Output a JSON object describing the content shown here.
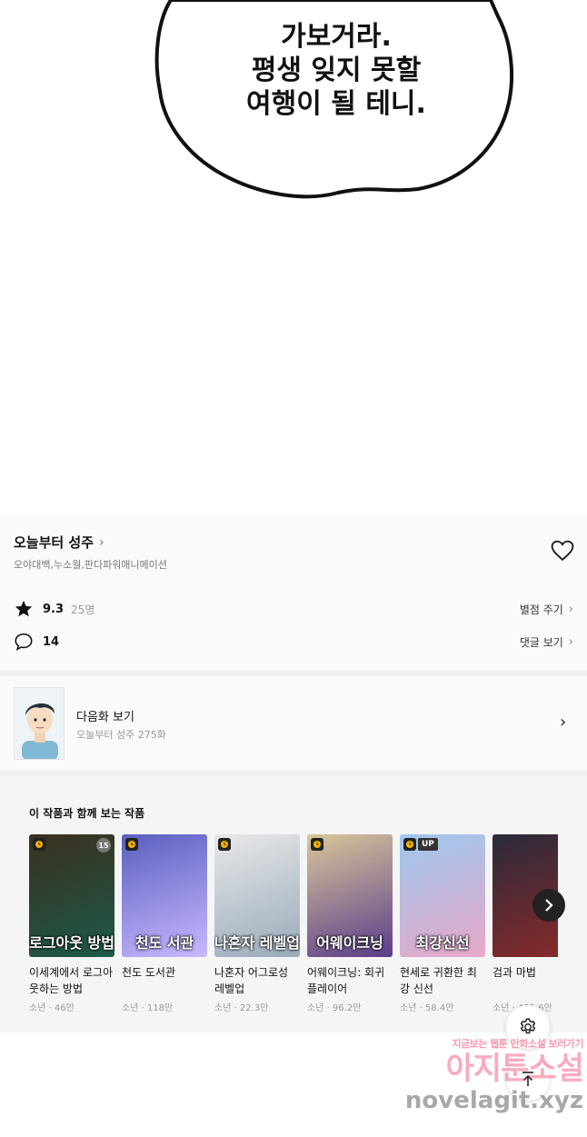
{
  "comic": {
    "speech_lines": [
      "가보거라.",
      "평생 잊지 못할",
      "여행이 될 테니."
    ]
  },
  "series": {
    "title": "오늘부터 성주",
    "authors": "오야대백,누소월,판다파워애니메이션",
    "rating": "9.3",
    "rating_count": "25명",
    "rate_label": "별점 주기",
    "comment_count": "14",
    "comment_label": "댓글 보기"
  },
  "next_episode": {
    "label": "다음화 보기",
    "subtitle": "오늘부터 성주 275화"
  },
  "recommendations": {
    "heading": "이 작품과 함께 보는 작품",
    "items": [
      {
        "name": "이세계에서 로그아웃하는 방법",
        "stat": "소년 · 46만",
        "cover_text": "로그아웃 방법",
        "age": "15",
        "up": "",
        "colors": [
          "#3a2f1e",
          "#1d5a4a"
        ]
      },
      {
        "name": "천도 도서관",
        "stat": "소년 · 118만",
        "cover_text": "천도 서관",
        "age": "",
        "up": "",
        "colors": [
          "#5a5fc0",
          "#c9b8ff"
        ]
      },
      {
        "name": "나혼자 어그로성 레벨업",
        "stat": "소년 · 22.3만",
        "cover_text": "나혼자 레벨업",
        "age": "",
        "up": "",
        "colors": [
          "#e8e8e8",
          "#9ab"
        ]
      },
      {
        "name": "어웨이크닝: 회귀 플레이어",
        "stat": "소년 · 96.2만",
        "cover_text": "어웨이크닝",
        "age": "",
        "up": "",
        "colors": [
          "#d8c79a",
          "#5b3d8a"
        ]
      },
      {
        "name": "현세로 귀환한 최강 신선",
        "stat": "소년 · 58.4만",
        "cover_text": "최강신선",
        "age": "",
        "up": "UP",
        "colors": [
          "#9ec8ef",
          "#e7a7c8"
        ]
      },
      {
        "name": "검과 마법",
        "stat": "소년 · 431.6만",
        "cover_text": "",
        "age": "",
        "up": "",
        "colors": [
          "#2a2a3a",
          "#8a2a2a"
        ]
      }
    ]
  },
  "watermark": {
    "line1": "지금보는 웹툰 만화소설 보러가기",
    "line2": "아지툰소설",
    "line3": "novelagit.xyz"
  },
  "icons": {
    "heart": "heart-outline-icon",
    "star": "star-icon",
    "comment": "speech-bubble-icon",
    "settings": "gear-icon",
    "scroll_top": "arrow-up-icon"
  }
}
